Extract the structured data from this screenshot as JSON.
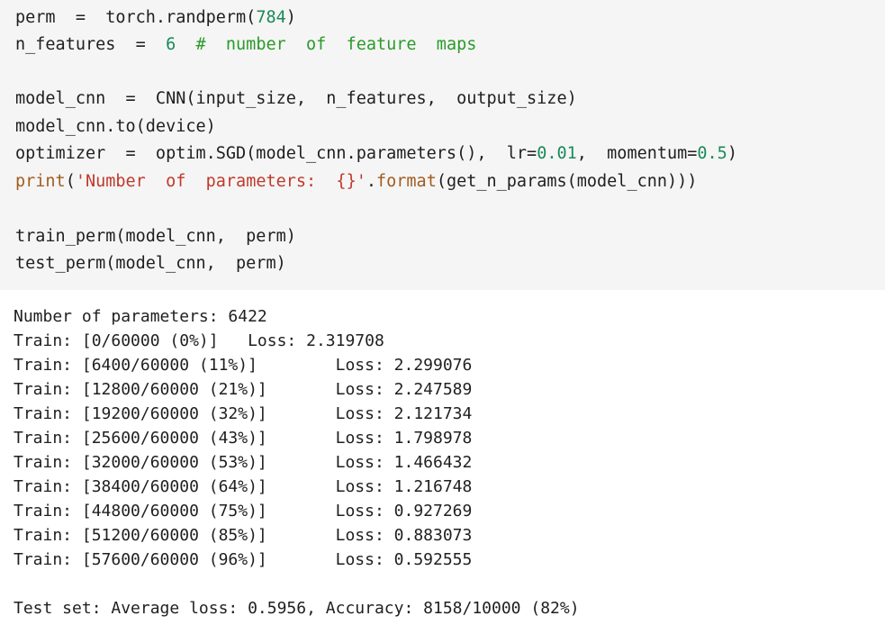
{
  "code_cell": {
    "line1": {
      "a": "perm  =  torch.randperm(",
      "num": "784",
      "b": ")"
    },
    "line2": {
      "a": "n_features  =  ",
      "num": "6",
      "comment": "  #  number  of  feature  maps"
    },
    "line4": {
      "text": "model_cnn  =  CNN(input_size,  n_features,  output_size)"
    },
    "line5": {
      "text": "model_cnn.to(device)"
    },
    "line6": {
      "a": "optimizer  =  optim.SGD(model_cnn.parameters(),  lr=",
      "num1": "0.01",
      "b": ",  momentum=",
      "num2": "0.5",
      "c": ")"
    },
    "line7": {
      "builtin1": "print",
      "p1": "(",
      "str": "'Number  of  parameters:  {}'",
      "dot": ".",
      "builtin2": "format",
      "rest": "(get_n_params(model_cnn)))"
    },
    "line9": {
      "text": "train_perm(model_cnn,  perm)"
    },
    "line10": {
      "text": "test_perm(model_cnn,  perm)"
    }
  },
  "output": {
    "lines": [
      "Number of parameters: 6422",
      "Train: [0/60000 (0%)]   Loss: 2.319708",
      "Train: [6400/60000 (11%)]        Loss: 2.299076",
      "Train: [12800/60000 (21%)]       Loss: 2.247589",
      "Train: [19200/60000 (32%)]       Loss: 2.121734",
      "Train: [25600/60000 (43%)]       Loss: 1.798978",
      "Train: [32000/60000 (53%)]       Loss: 1.466432",
      "Train: [38400/60000 (64%)]       Loss: 1.216748",
      "Train: [44800/60000 (75%)]       Loss: 0.927269",
      "Train: [51200/60000 (85%)]       Loss: 0.883073",
      "Train: [57600/60000 (96%)]       Loss: 0.592555"
    ],
    "test_line": "Test set: Average loss: 0.5956, Accuracy: 8158/10000 (82%)"
  },
  "colors": {
    "code_bg": "#f5f5f5",
    "number": "#1a8a5a",
    "comment": "#2a9a2a",
    "builtin": "#a15c1f",
    "string": "#c0392b"
  }
}
